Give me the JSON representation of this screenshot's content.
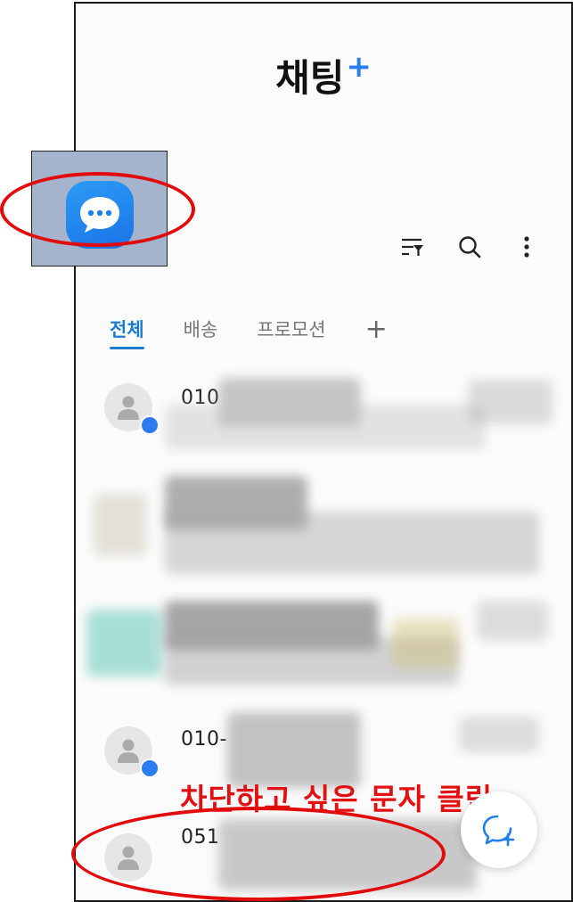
{
  "app": {
    "title": "채팅",
    "title_plus": "+"
  },
  "toolbar": {
    "filter_icon": "filter-icon",
    "search_icon": "search-icon",
    "more_icon": "more-vertical-icon"
  },
  "tabs": [
    {
      "label": "전체",
      "active": true
    },
    {
      "label": "배송",
      "active": false
    },
    {
      "label": "프로모션",
      "active": false
    }
  ],
  "tab_add": "+",
  "conversations": [
    {
      "name": "010"
    },
    {
      "name": "010-"
    },
    {
      "name": "051"
    }
  ],
  "annotation": {
    "instruction": "차단하고 싶은 문자 클릭"
  },
  "colors": {
    "accent": "#1e7ccf",
    "annotation_red": "#e21010",
    "badge_blue": "#2b7bf1"
  }
}
